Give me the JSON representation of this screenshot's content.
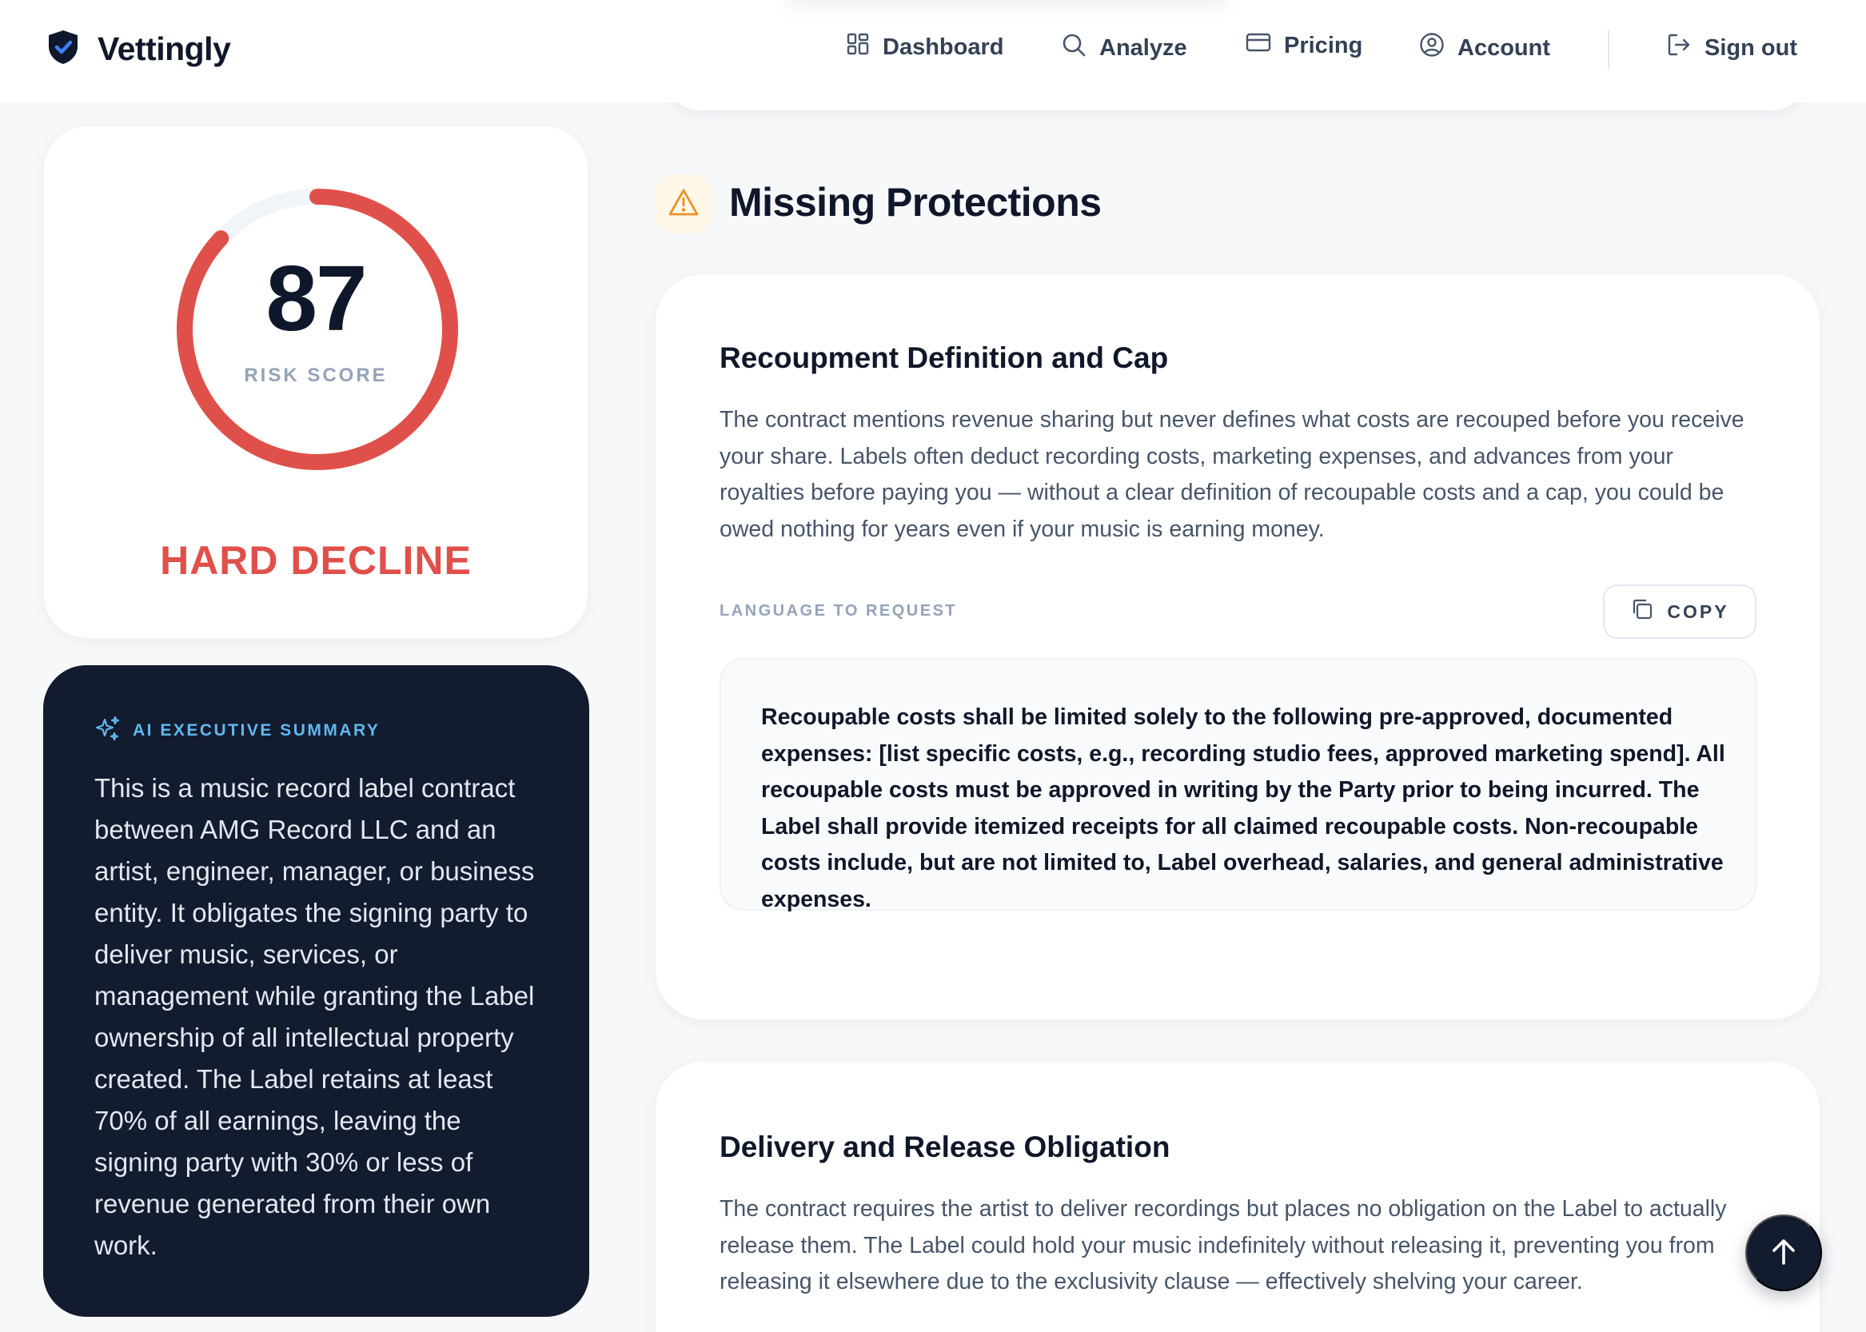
{
  "brand": {
    "name": "Vettingly",
    "icon": "shield-check-icon",
    "color": "#0f172a",
    "accent": "#3b82f6"
  },
  "nav": {
    "items": [
      {
        "label": "Dashboard",
        "icon": "grid-icon"
      },
      {
        "label": "Analyze",
        "icon": "search-icon"
      },
      {
        "label": "Pricing",
        "icon": "credit-card-icon"
      },
      {
        "label": "Account",
        "icon": "user-circle-icon"
      }
    ],
    "sign_out": {
      "label": "Sign out",
      "icon": "sign-out-icon"
    }
  },
  "score": {
    "value": "87",
    "label": "RISK SCORE",
    "fraction": 0.87,
    "verdict": "HARD DECLINE",
    "color": "#e0504a"
  },
  "summary": {
    "heading": "AI EXECUTIVE SUMMARY",
    "icon": "sparkles-icon",
    "text": "This is a music record label contract between AMG Record LLC and an artist, engineer, manager, or business entity. It obligates the signing party to deliver music, services, or management while granting the Label ownership of all intellectual property created. The Label retains at least 70% of all earnings, leaving the signing party with 30% or less of revenue generated from their own work."
  },
  "section": {
    "title": "Missing Protections",
    "icon": "warning-icon",
    "accent": "#e8932b"
  },
  "protections": [
    {
      "title": "Recoupment Definition and Cap",
      "description": "The contract mentions revenue sharing but never defines what costs are recouped before you receive your share. Labels often deduct recording costs, marketing expenses, and advances from your royalties before paying you — without a clear definition of recoupable costs and a cap, you could be owed nothing for years even if your music is earning money.",
      "language_label": "LANGUAGE TO REQUEST",
      "copy_label": "COPY",
      "language": "Recoupable costs shall be limited solely to the following pre-approved, documented expenses: [list specific costs, e.g., recording studio fees, approved marketing spend]. All recoupable costs must be approved in writing by the Party prior to being incurred. The Label shall provide itemized receipts for all claimed recoupable costs. Non-recoupable costs include, but are not limited to, Label overhead, salaries, and general administrative expenses."
    },
    {
      "title": "Delivery and Release Obligation",
      "description": "The contract requires the artist to deliver recordings but places no obligation on the Label to actually release them. The Label could hold your music indefinitely without releasing it, preventing you from releasing it elsewhere due to the exclusivity clause — effectively shelving your career."
    }
  ],
  "scroll_top": {
    "icon": "arrow-up-icon"
  }
}
